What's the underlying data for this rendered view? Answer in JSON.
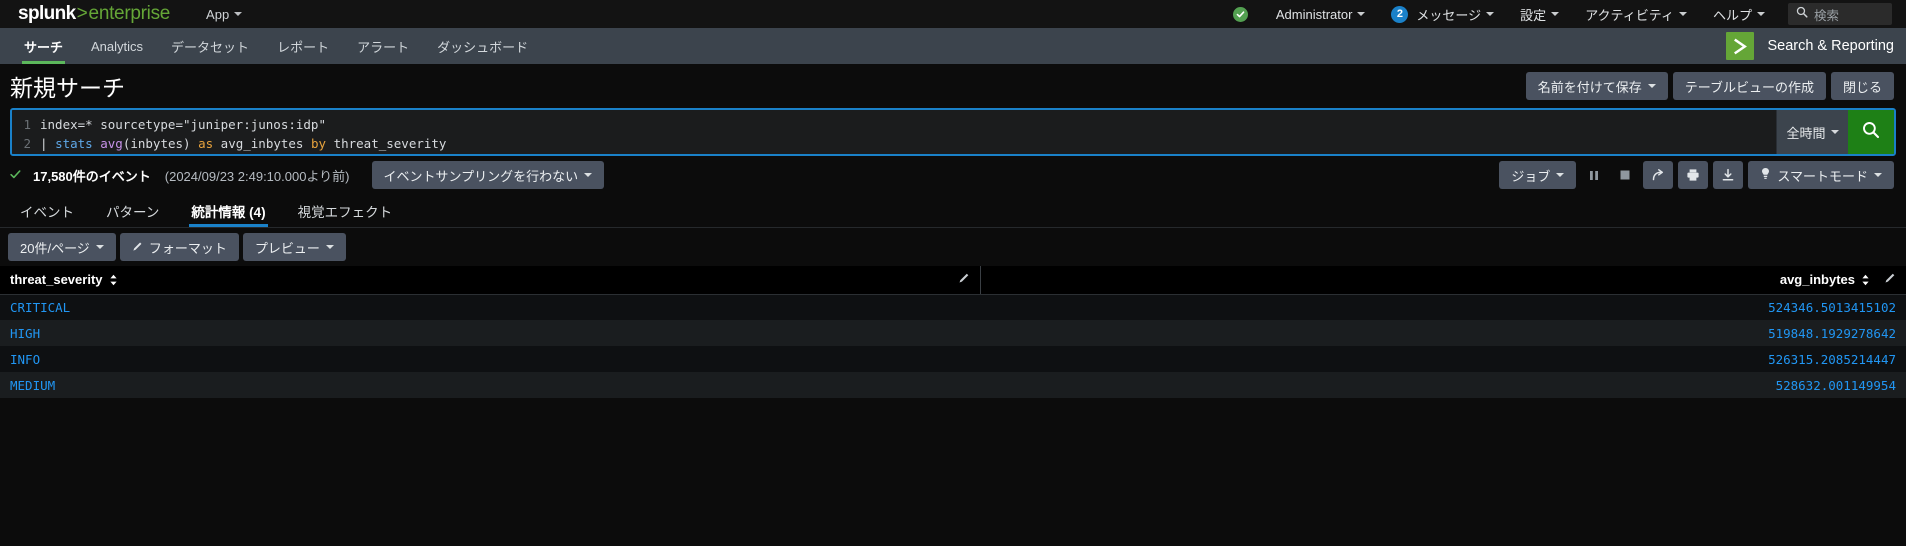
{
  "brand": {
    "name_bold": "splunk",
    "gt": ">",
    "name_light": "enterprise"
  },
  "topbar": {
    "app_menu": "App",
    "health_icon": "health-check-icon",
    "user": "Administrator",
    "messages_count": "2",
    "messages": "メッセージ",
    "settings": "設定",
    "activity": "アクティビティ",
    "help": "ヘルプ",
    "search_placeholder": "検索",
    "search_icon": "search-icon"
  },
  "appnav": {
    "tabs": [
      {
        "label": "サーチ",
        "active": true
      },
      {
        "label": "Analytics",
        "active": false
      },
      {
        "label": "データセット",
        "active": false
      },
      {
        "label": "レポート",
        "active": false
      },
      {
        "label": "アラート",
        "active": false
      },
      {
        "label": "ダッシュボード",
        "active": false
      }
    ],
    "app_name": "Search & Reporting",
    "app_icon": "chevron-right-logo-icon"
  },
  "title": {
    "page_title": "新規サーチ",
    "save_as": "名前を付けて保存",
    "create_table_view": "テーブルビューの作成",
    "close": "閉じる"
  },
  "search": {
    "lines": [
      {
        "no": "1",
        "text": "index=* sourcetype=\"juniper:junos:idp\""
      },
      {
        "no": "2",
        "text": "| stats avg(inbytes) as avg_inbytes by threat_severity"
      }
    ],
    "time_range": "全時間",
    "run_icon": "search-icon",
    "accent_color": "#1a81c9"
  },
  "status": {
    "check_icon": "checkmark-icon",
    "event_count": "17,580件のイベント",
    "event_time": "(2024/09/23 2:49:10.000より前)",
    "sampling": "イベントサンプリングを行わない",
    "job": "ジョブ",
    "pause_icon": "pause-icon",
    "stop_icon": "stop-icon",
    "share_icon": "share-icon",
    "print_icon": "print-icon",
    "export_icon": "export-download-icon",
    "mode": "スマートモード",
    "mode_icon": "lightbulb-icon"
  },
  "result_tabs": [
    {
      "label": "イベント",
      "active": false
    },
    {
      "label": "パターン",
      "active": false
    },
    {
      "label": "統計情報 (4)",
      "active": true
    },
    {
      "label": "視覚エフェクト",
      "active": false
    }
  ],
  "table_toolbar": {
    "per_page": "20件/ページ",
    "format": "フォーマット",
    "format_icon": "pencil-icon",
    "preview": "プレビュー"
  },
  "table": {
    "columns": [
      {
        "name": "threat_severity",
        "sort_icon": "sort-updown-icon",
        "edit_icon": "pencil-icon"
      },
      {
        "name": "avg_inbytes",
        "sort_icon": "sort-updown-icon",
        "edit_icon": "pencil-icon"
      }
    ],
    "rows": [
      {
        "threat_severity": "CRITICAL",
        "avg_inbytes": "524346.5013415102"
      },
      {
        "threat_severity": "HIGH",
        "avg_inbytes": "519848.1929278642"
      },
      {
        "threat_severity": "INFO",
        "avg_inbytes": "526315.2085214447"
      },
      {
        "threat_severity": "MEDIUM",
        "avg_inbytes": "528632.001149954"
      }
    ]
  },
  "colors": {
    "splunk_green": "#65a637",
    "accent_blue": "#1a81c9",
    "link_blue": "#2196f3",
    "run_green": "#1e8016"
  }
}
